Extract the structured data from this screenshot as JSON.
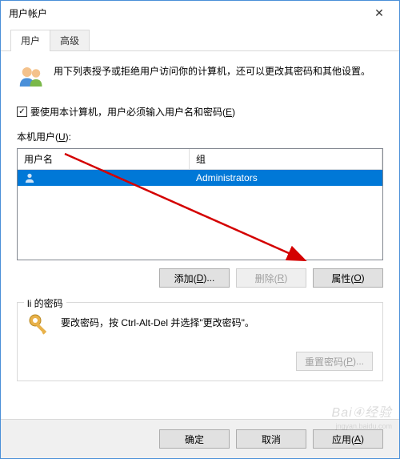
{
  "window": {
    "title": "用户帐户"
  },
  "tabs": [
    {
      "label": "用户",
      "active": true
    },
    {
      "label": "高级",
      "active": false
    }
  ],
  "header": {
    "description": "用下列表授予或拒绝用户访问你的计算机，还可以更改其密码和其他设置。"
  },
  "checkbox": {
    "checked": true,
    "label_before": "要使用本计算机，用户必须输入用户名和密码(",
    "label_mnemonic": "E",
    "label_after": ")"
  },
  "list_label": {
    "before": "本机用户(",
    "mnemonic": "U",
    "after": "):"
  },
  "listview": {
    "columns": [
      "用户名",
      "组"
    ],
    "rows": [
      {
        "username": "",
        "group": "Administrators",
        "selected": true
      }
    ]
  },
  "user_buttons": {
    "add": {
      "before": "添加(",
      "mnemonic": "D",
      "after": ")..."
    },
    "remove": {
      "before": "删除(",
      "mnemonic": "R",
      "after": ")",
      "disabled": true
    },
    "properties": {
      "before": "属性(",
      "mnemonic": "O",
      "after": ")"
    }
  },
  "password_group": {
    "title": "li 的密码",
    "text": "要改密码，按 Ctrl-Alt-Del 并选择\"更改密码\"。",
    "reset_btn": {
      "before": "重置密码(",
      "mnemonic": "P",
      "after": ")...",
      "disabled": true
    }
  },
  "footer": {
    "ok": "确定",
    "cancel": "取消",
    "apply_before": "应用(",
    "apply_mnemonic": "A",
    "apply_after": ")"
  },
  "watermark": {
    "main": "Bai④经验",
    "sub": "jngyan.baidu.com"
  }
}
